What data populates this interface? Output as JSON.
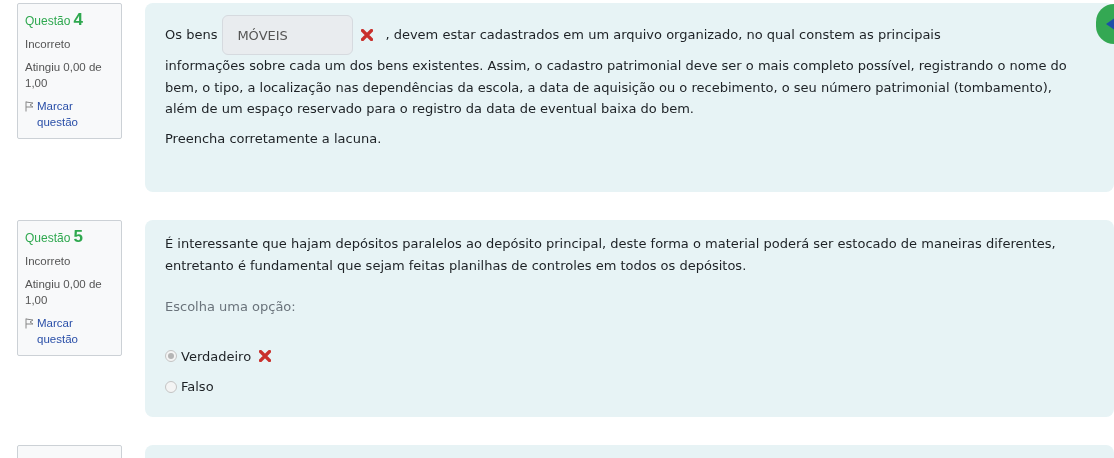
{
  "questions": [
    {
      "kind": "fill_in",
      "label": "Questão",
      "number": "4",
      "state": "Incorreto",
      "grade": "Atingiu 0,00 de 1,00",
      "flag": "Marcar questão",
      "text_before": "Os bens",
      "answer": "MÓVEIS",
      "correct": false,
      "text_after": ", devem estar cadastrados em um arquivo organizado, no qual constem as principais",
      "text_continued": "informações sobre cada um dos bens existentes. Assim, o cadastro patrimonial deve ser o mais completo possível, registrando o nome do bem, o tipo, a localização nas dependências da escola, a data de aquisição ou o recebimento, o seu número patrimonial (tombamento), além de um espaço reservado para o registro da data de eventual baixa do bem.",
      "instruction": "Preencha corretamente a lacuna."
    },
    {
      "kind": "true_false",
      "label": "Questão",
      "number": "5",
      "state": "Incorreto",
      "grade": "Atingiu 0,00 de 1,00",
      "flag": "Marcar questão",
      "text": "É interessante que hajam depósitos paralelos ao depósito principal, deste forma o material poderá ser estocado de maneiras diferentes, entretanto é fundamental que sejam feitas planilhas de controles em todos os depósitos.",
      "prompt": "Escolha uma opção:",
      "options": [
        {
          "label": "Verdadeiro",
          "selected": true,
          "marked_wrong": true
        },
        {
          "label": "Falso",
          "selected": false
        }
      ]
    },
    {
      "kind": "cut_off"
    }
  ]
}
